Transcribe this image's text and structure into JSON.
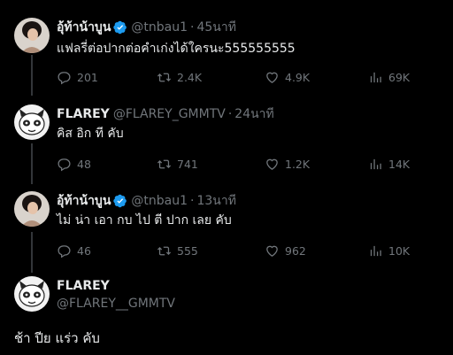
{
  "tweets": [
    {
      "display_name": "อุ้ท้าน้าบูน",
      "handle": "@tnbau1",
      "time": "45นาที",
      "text": "แฟลรี่ต่อปากต่อคำเก่งได้ใครนะ555555555",
      "replies": "201",
      "retweets": "2.4K",
      "likes": "4.9K",
      "views": "69K"
    },
    {
      "display_name": "FLAREY",
      "handle": "@FLAREY_GMMTV",
      "time": "24นาที",
      "text": "คิส อิก ที คับ",
      "replies": "48",
      "retweets": "741",
      "likes": "1.2K",
      "views": "14K"
    },
    {
      "display_name": "อุ้ท้าน้าบูน",
      "handle": "@tnbau1",
      "time": "13นาที",
      "text": "ไม่ น่า เอา กบ ไป ตี ปาก เลย คับ",
      "replies": "46",
      "retweets": "555",
      "likes": "962",
      "views": "10K"
    }
  ],
  "main_tweet": {
    "display_name": "FLAREY",
    "handle": "@FLAREY__GMMTV",
    "text": "ช้า ปีย แร่ว คับ"
  },
  "separator": "·",
  "colors": {
    "background": "#000000",
    "text": "#e7e9ea",
    "muted": "#71767b",
    "verified": "#1d9bf0",
    "thread_line": "#333639"
  },
  "icons": [
    "reply-icon",
    "retweet-icon",
    "like-icon",
    "views-icon",
    "verified-badge-icon"
  ]
}
